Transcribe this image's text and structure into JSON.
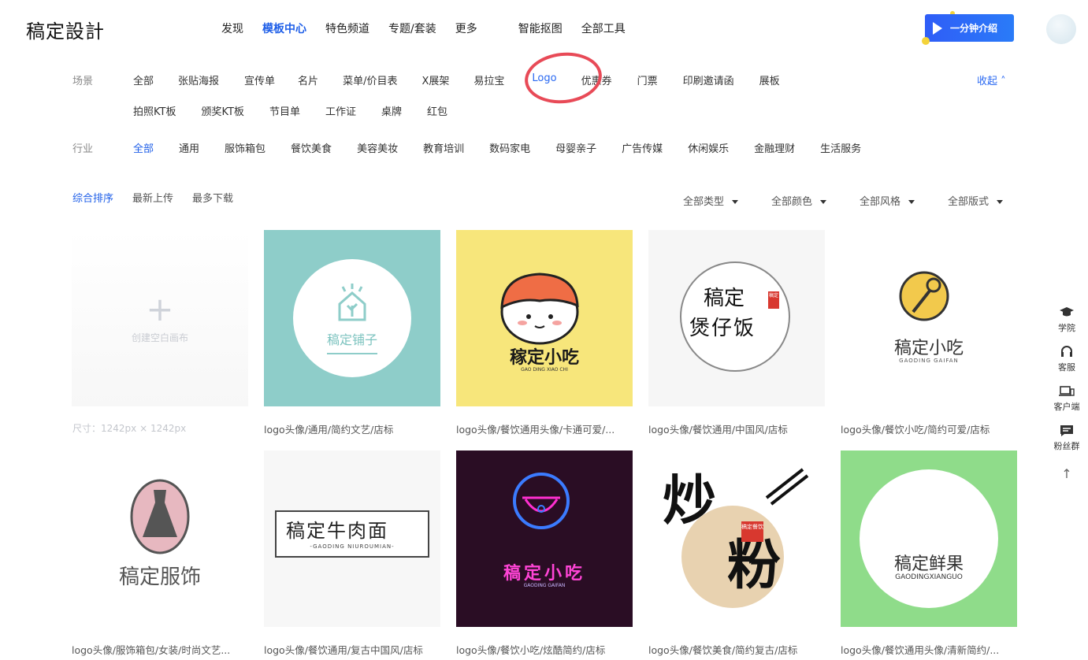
{
  "brand": {
    "logo_text": "稿定設計"
  },
  "topnav": {
    "items": [
      "发现",
      "模板中心",
      "特色频道",
      "专题/套装",
      "更多",
      "智能抠图",
      "全部工具"
    ]
  },
  "promo": {
    "label": "一分钟介绍"
  },
  "filters": {
    "scene_label": "场景",
    "scene_row1": [
      "全部",
      "张贴海报",
      "宣传单",
      "名片",
      "菜单/价目表",
      "X展架",
      "易拉宝",
      "Logo",
      "优惠券",
      "门票",
      "印刷邀请函",
      "展板"
    ],
    "scene_row2": [
      "拍照KT板",
      "颁奖KT板",
      "节目单",
      "工作证",
      "桌牌",
      "红包"
    ],
    "collapse_label": "收起",
    "industry_label": "行业",
    "industry": [
      "全部",
      "通用",
      "服饰箱包",
      "餐饮美食",
      "美容美妆",
      "教育培训",
      "数码家电",
      "母婴亲子",
      "广告传媒",
      "休闲娱乐",
      "金融理财",
      "生活服务"
    ]
  },
  "sort": {
    "options": [
      "综合排序",
      "最新上传",
      "最多下载"
    ]
  },
  "dropdowns": [
    "全部类型",
    "全部颜色",
    "全部风格",
    "全部版式"
  ],
  "blank_card": {
    "label": "创建空白画布",
    "size": "尺寸：1242px × 1242px"
  },
  "cards": [
    {
      "caption": "logo头像/通用/简约文艺/店标",
      "title": "稿定铺子"
    },
    {
      "caption": "logo头像/餐饮通用头像/卡通可爱/...",
      "title": "稼定小吃",
      "sub": "GAO DING XIAO CHI"
    },
    {
      "caption": "logo头像/餐饮通用/中国风/店标",
      "title1": "稿定",
      "title2": "煲仔饭",
      "stamp": "稿定"
    },
    {
      "caption": "logo头像/餐饮小吃/简约可爱/店标",
      "title": "稿定小吃",
      "sub": "GAODING GAIFAN"
    },
    {
      "caption": "logo头像/服饰箱包/女装/时尚文艺...",
      "title": "稿定服饰"
    },
    {
      "caption": "logo头像/餐饮通用/复古中国风/店标",
      "title": "稿定牛肉面",
      "sub": "-GAODING NIUROUMIAN-"
    },
    {
      "caption": "logo头像/餐饮小吃/炫酷简约/店标",
      "title": "稿定小吃",
      "sub": "GAODING GAIFAN"
    },
    {
      "caption": "logo头像/餐饮美食/简约复古/店标",
      "title1": "炒",
      "title2": "粉",
      "stamp": "稿定餐饮"
    },
    {
      "caption": "logo头像/餐饮通用头像/清新简约/...",
      "title": "稿定鲜果",
      "sub": "GAODINGXIANGUO"
    }
  ],
  "sidebar": {
    "items": [
      "学院",
      "客服",
      "客户端",
      "粉丝群"
    ]
  },
  "colors": {
    "accent": "#1f5fe8",
    "annotation": "#e84a57",
    "promo": "#2f5df7"
  }
}
